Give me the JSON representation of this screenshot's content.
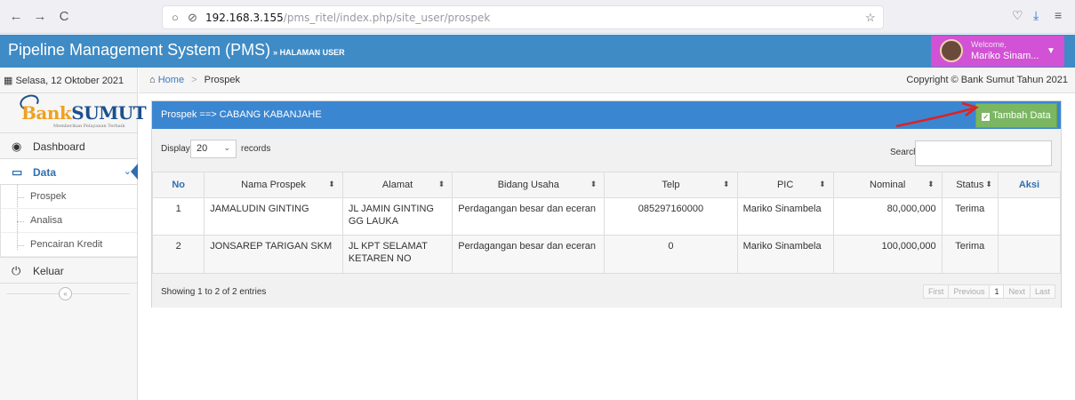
{
  "browser": {
    "back_icon": "←",
    "forward_icon": "→",
    "reload_icon": "C",
    "url_host": "192.168.3.155",
    "url_path": "/pms_ritel/index.php/site_user/prospek"
  },
  "header": {
    "title": "Pipeline Management System (PMS)",
    "subtitle": "» HALAMAN USER",
    "welcome": "Welcome,",
    "user_name": "Mariko Sinam...",
    "accent_color": "#3e8bc6",
    "user_box_color": "#d152d4"
  },
  "sidebar": {
    "date": "Selasa, 12 Oktober 2021",
    "logo_bank": "Bank",
    "logo_sumut": "SUMUT",
    "logo_tagline": "Memberikan Pelayanan Terbaik",
    "items": [
      {
        "label": "Dashboard",
        "icon": "dashboard-icon"
      },
      {
        "label": "Data",
        "icon": "monitor-icon"
      }
    ],
    "sub_items": [
      {
        "label": "Prospek"
      },
      {
        "label": "Analisa"
      },
      {
        "label": "Pencairan Kredit"
      }
    ],
    "logout_label": "Keluar"
  },
  "breadcrumb": {
    "home": "Home",
    "current": "Prospek",
    "copyright": "Copyright © Bank Sumut Tahun 2021"
  },
  "panel": {
    "title": "Prospek ==> CABANG KABANJAHE",
    "add_button": "Tambah Data",
    "display_label": "Display",
    "display_value": "20",
    "records_label": "records",
    "search_label": "Search:",
    "columns": [
      "No",
      "Nama Prospek",
      "Alamat",
      "Bidang Usaha",
      "Telp",
      "PIC",
      "Nominal",
      "Status",
      "Aksi"
    ],
    "rows": [
      {
        "no": "1",
        "nama": "JAMALUDIN GINTING",
        "alamat": "JL JAMIN GINTING GG LAUKA",
        "bidang": "Perdagangan besar dan eceran",
        "telp": "085297160000",
        "pic": "Mariko Sinambela",
        "nominal": "80,000,000",
        "status": "Terima",
        "aksi": ""
      },
      {
        "no": "2",
        "nama": "JONSAREP TARIGAN SKM",
        "alamat": "JL KPT SELAMAT KETAREN NO",
        "bidang": "Perdagangan besar dan eceran",
        "telp": "0",
        "pic": "Mariko Sinambela",
        "nominal": "100,000,000",
        "status": "Terima",
        "aksi": ""
      }
    ],
    "showing": "Showing 1 to 2 of 2 entries",
    "pager": {
      "first": "First",
      "previous": "Previous",
      "page": "1",
      "next": "Next",
      "last": "Last"
    }
  }
}
